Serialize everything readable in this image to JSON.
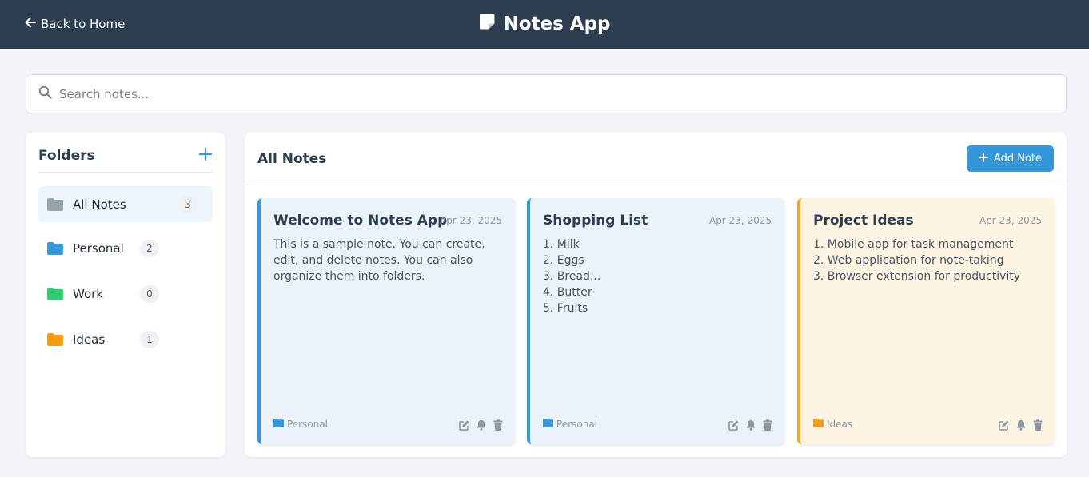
{
  "header": {
    "back_label": "Back to Home",
    "app_title": "Notes App"
  },
  "search": {
    "placeholder": "Search notes...",
    "value": ""
  },
  "sidebar": {
    "title": "Folders",
    "folders": [
      {
        "label": "All Notes",
        "count": "3",
        "color": "#95a5a6",
        "active": true
      },
      {
        "label": "Personal",
        "count": "2",
        "color": "#3498db",
        "active": false
      },
      {
        "label": "Work",
        "count": "0",
        "color": "#2ecc71",
        "active": false
      },
      {
        "label": "Ideas",
        "count": "1",
        "color": "#f39c12",
        "active": false
      }
    ]
  },
  "main": {
    "title": "All Notes",
    "add_note_label": "Add Note",
    "notes": [
      {
        "title": "Welcome to Notes App",
        "date": "Apr 23, 2025",
        "body": "This is a sample note. You can create, edit, and delete notes. You can also organize them into folders.",
        "folder": "Personal",
        "folder_color": "#3498db"
      },
      {
        "title": "Shopping List",
        "date": "Apr 23, 2025",
        "body": "1. Milk\n2. Eggs\n3. Bread...\n4. Butter\n5. Fruits",
        "folder": "Personal",
        "folder_color": "#3498db"
      },
      {
        "title": "Project Ideas",
        "date": "Apr 23, 2025",
        "body": "1. Mobile app for task management\n2. Web application for note-taking\n3. Browser extension for productivity",
        "folder": "Ideas",
        "folder_color": "#f39c12"
      }
    ]
  },
  "colors": {
    "header_bg": "#2c3e50",
    "accent": "#3498db",
    "page_bg": "#f3f4f8"
  },
  "icons": [
    "arrow-left-icon",
    "sticky-note-icon",
    "search-icon",
    "plus-icon",
    "folder-icon",
    "edit-icon",
    "bell-icon",
    "trash-icon"
  ]
}
